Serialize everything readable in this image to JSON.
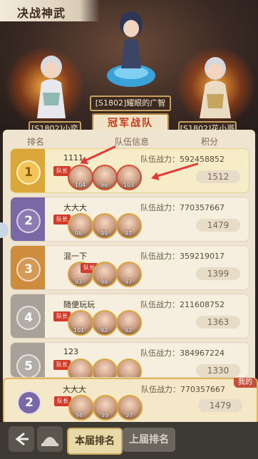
{
  "hero": {
    "title": "决战神武",
    "champion_label": "冠军战队",
    "plates": {
      "center": "[S1802]耀眼的广智",
      "left": "[S1802]小奕",
      "right": "[S1802]花小哥"
    }
  },
  "table": {
    "headers": [
      "排名",
      "队伍信息",
      "积分"
    ]
  },
  "power_prefix": "队伍战力：",
  "captain_label": "队长",
  "rows": [
    {
      "rank": "1",
      "name": "1111",
      "power": "592458852",
      "score": "1512",
      "levels": [
        "104",
        "96",
        "103"
      ]
    },
    {
      "rank": "2",
      "name": "大大大",
      "power": "770357667",
      "score": "1479",
      "levels": [
        "98",
        "99",
        "97"
      ]
    },
    {
      "rank": "3",
      "name": "混一下",
      "power": "359219017",
      "score": "1399",
      "levels": [
        "93",
        "98",
        "97"
      ]
    },
    {
      "rank": "4",
      "name": "随便玩玩",
      "power": "211608752",
      "score": "1363",
      "levels": [
        "101",
        "92",
        "92"
      ]
    },
    {
      "rank": "5",
      "name": "123",
      "power": "384967224",
      "score": "1330",
      "levels": [
        "",
        "",
        ""
      ]
    }
  ],
  "my_row": {
    "tag": "我的",
    "rank": "2",
    "name": "大大大",
    "power": "770357667",
    "score": "1479",
    "levels": [
      "98",
      "99",
      "97"
    ]
  },
  "tabs": {
    "current": "本届排名",
    "previous": "上届排名"
  },
  "colors": {
    "gold": "#d9a73a",
    "purple": "#7a67a6",
    "orange": "#cf8c3d",
    "gray": "#a7a19a",
    "red_arrow": "#e53935"
  }
}
